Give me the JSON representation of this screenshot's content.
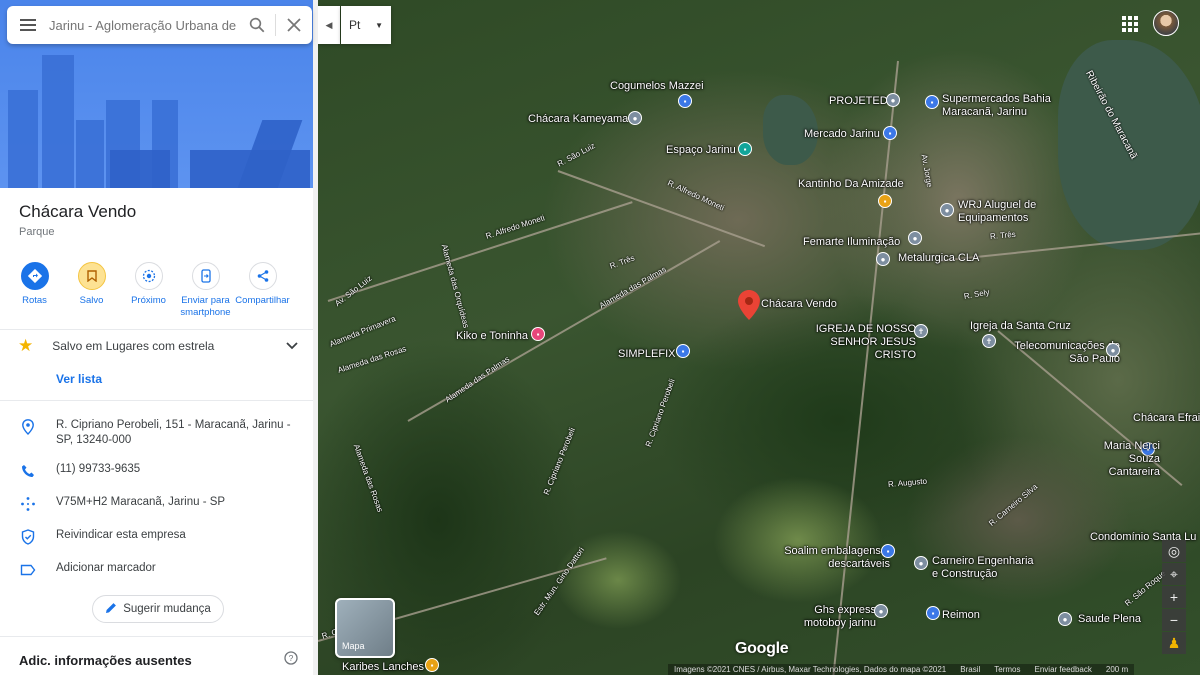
{
  "search": {
    "placeholder": "Jarinu - Aglomeração Urbana de ..."
  },
  "place": {
    "title": "Chácara Vendo",
    "type": "Parque"
  },
  "actions": [
    {
      "label": "Rotas",
      "icon": "directions-icon"
    },
    {
      "label": "Salvo",
      "icon": "bookmark-icon"
    },
    {
      "label": "Próximo",
      "icon": "nearby-icon"
    },
    {
      "label": "Enviar para smartphone",
      "icon": "send-to-phone-icon"
    },
    {
      "label": "Compartilhar",
      "icon": "share-icon"
    }
  ],
  "saved": {
    "text": "Salvo em Lugares com estrela",
    "view_list": "Ver lista"
  },
  "info": {
    "address": "R. Cipriano Perobeli, 151 - Maracanã, Jarinu - SP, 13240-000",
    "phone": "(11) 99733-9635",
    "plus_code": "V75M+H2 Maracanã, Jarinu - SP",
    "claim": "Reivindicar esta empresa",
    "label": "Adicionar marcador"
  },
  "suggest_label": "Sugerir mudança",
  "missing_title": "Adic. informações ausentes",
  "layer_selector": "Pt",
  "layer_thumb": "Mapa",
  "map": {
    "logo": "Google",
    "attribution": [
      "Imagens ©2021 CNES / Airbus, Maxar Technologies, Dados do mapa ©2021",
      "Brasil",
      "Termos",
      "Enviar feedback",
      "200 m"
    ],
    "places": [
      {
        "name": "Cogumelos Mazzei"
      },
      {
        "name": "Chácara Kameyama"
      },
      {
        "name": "Espaço Jarinu"
      },
      {
        "name": "PROJETED"
      },
      {
        "name": "Supermercados Bahia Maracanã, Jarinu"
      },
      {
        "name": "Mercado Jarinu"
      },
      {
        "name": "Kantinho Da Amizade"
      },
      {
        "name": "WRJ Aluguel de Equipamentos"
      },
      {
        "name": "Femarte Iluminação"
      },
      {
        "name": "Metalurgica CLA"
      },
      {
        "name": "Chácara Vendo"
      },
      {
        "name": "IGREJA DE NOSSO SENHOR JESUS CRISTO"
      },
      {
        "name": "Igreja da Santa Cruz"
      },
      {
        "name": "Telecomunicações de São Paulo"
      },
      {
        "name": "Kiko e Toninha"
      },
      {
        "name": "SIMPLEFIX"
      },
      {
        "name": "Chácara Efrai"
      },
      {
        "name": "Maria Nerci Souza Cantareira"
      },
      {
        "name": "Condomínio Santa Lu"
      },
      {
        "name": "Soalim embalagens e descartáveis"
      },
      {
        "name": "Carneiro Engenharia e Construção"
      },
      {
        "name": "Ghs express motoboy jarinu"
      },
      {
        "name": "Reimon"
      },
      {
        "name": "Saude Plena"
      },
      {
        "name": "Karibes Lanches"
      }
    ],
    "roads": [
      "R. São Luiz",
      "Av. São Luiz",
      "R. Alfredo Moneti",
      "R. Alfredo Moneti",
      "Alameda Primavera",
      "Alameda das Orquídeas",
      "R. Três",
      "Alameda das Palmas",
      "Alameda das Rosas",
      "Alameda das Palmas",
      "Alameda das Rosas",
      "R. Cipriano Perobeli",
      "R. Cipriano Perobeli",
      "R. Cipriano Perobeli",
      "Estr. Mun. Gino Dattori",
      "Ribeirão do Maracanã",
      "R. Três",
      "R. Sely",
      "R. Augusto",
      "R. Carneiro Silva",
      "R. São Roque",
      "Av. Jorge"
    ],
    "ribeirao": "Ribeirão do Maracanã"
  }
}
